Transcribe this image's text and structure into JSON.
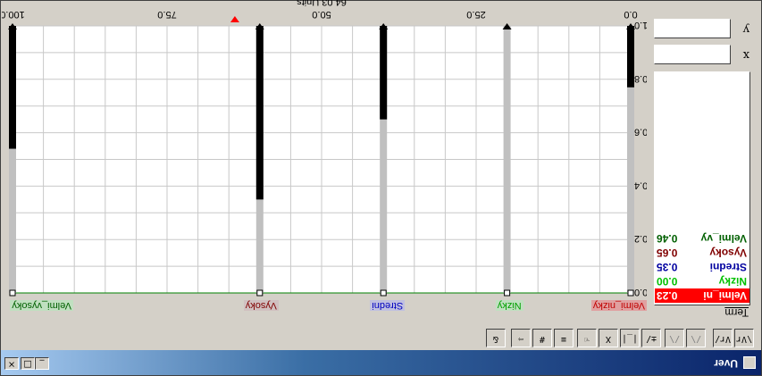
{
  "window": {
    "title": "Uver",
    "buttons": {
      "minimize": "_",
      "maximize": "□",
      "close": "×"
    }
  },
  "toolbar": {
    "buttons": [
      {
        "name": "Vr-left-button",
        "label": "\\Vr",
        "disabled": false
      },
      {
        "name": "Vr-right-button",
        "label": "Vr/",
        "disabled": false
      },
      {
        "name": "shape-a-button",
        "label": "/\\",
        "disabled": true
      },
      {
        "name": "shape-b-button",
        "label": "/\\",
        "disabled": true
      },
      {
        "name": "edit-term-button",
        "label": "±/",
        "disabled": false
      },
      {
        "name": "bracket-button",
        "label": "|_|",
        "disabled": false
      },
      {
        "name": "xmark-button",
        "label": "X",
        "disabled": false
      },
      {
        "name": "hand-button",
        "label": "☜",
        "disabled": false
      },
      {
        "name": "list-button",
        "label": "≡",
        "disabled": false
      },
      {
        "name": "grid-button",
        "label": "#",
        "disabled": false
      },
      {
        "name": "export-button",
        "label": "⇨",
        "disabled": false
      },
      {
        "name": "info-button",
        "label": "&",
        "disabled": false
      }
    ]
  },
  "terms_panel": {
    "header": "Term",
    "items": [
      {
        "name": "Velmi_ni",
        "value": "0.23",
        "color": "#ffffff",
        "selected": true
      },
      {
        "name": "Nizky",
        "value": "0.00",
        "color": "#00c000",
        "selected": false
      },
      {
        "name": "Stredni",
        "value": "0.35",
        "color": "#0000a0",
        "selected": false
      },
      {
        "name": "Vysoky",
        "value": "0.65",
        "color": "#800000",
        "selected": false
      },
      {
        "name": "Velmi_vy",
        "value": "0.46",
        "color": "#006000",
        "selected": false
      }
    ],
    "x_label": "x",
    "y_label": "y",
    "x_value": "",
    "y_value": ""
  },
  "chart_data": {
    "type": "line",
    "title": "64.03 Units",
    "x_ticks": [
      "0.0",
      "25.0",
      "50.0",
      "75.0",
      "100.0"
    ],
    "y_ticks": [
      "0.0",
      "0.2",
      "0.4",
      "0.6",
      "0.8",
      "1.0"
    ],
    "xlim": [
      0,
      100
    ],
    "ylim": [
      0,
      1
    ],
    "grid": true,
    "current_value": 64.03,
    "series": [
      {
        "name": "Velmi_nizky",
        "color": "#c00000",
        "x": [
          0,
          0,
          50,
          100
        ],
        "y": [
          1,
          0,
          0,
          0
        ]
      },
      {
        "name": "Nizky",
        "color": "#00c000",
        "x": [
          0,
          50,
          100
        ],
        "y": [
          0,
          0,
          0
        ]
      },
      {
        "name": "Stredni",
        "color": "#0000c0",
        "x": [
          0,
          50,
          100
        ],
        "y": [
          0,
          0,
          0
        ]
      },
      {
        "name": "Vysoky",
        "color": "#800000",
        "x": [
          0,
          50,
          100
        ],
        "y": [
          0,
          0,
          0
        ]
      },
      {
        "name": "Velmi_vysoky",
        "color": "#008000",
        "x": [
          0,
          50,
          100
        ],
        "y": [
          0,
          0,
          0
        ]
      }
    ],
    "term_markers": [
      {
        "label": "Velmi_nizky",
        "x": 0,
        "label_bg": "#e0a0a0",
        "label_color": "#c00000",
        "level": 0.23
      },
      {
        "label": "Nizky",
        "x": 20,
        "label_bg": "#c0e0c0",
        "label_color": "#00a000",
        "level": 0.0
      },
      {
        "label": "Stredni",
        "x": 40,
        "label_bg": "#c0c0e0",
        "label_color": "#0000c0",
        "level": 0.35
      },
      {
        "label": "Vysoky",
        "x": 60,
        "label_bg": "#d0c0c0",
        "label_color": "#800000",
        "level": 0.65
      },
      {
        "label": "Velmi_vysoky",
        "x": 100,
        "label_bg": "#c0e0c0",
        "label_color": "#006000",
        "level": 0.46
      }
    ]
  }
}
